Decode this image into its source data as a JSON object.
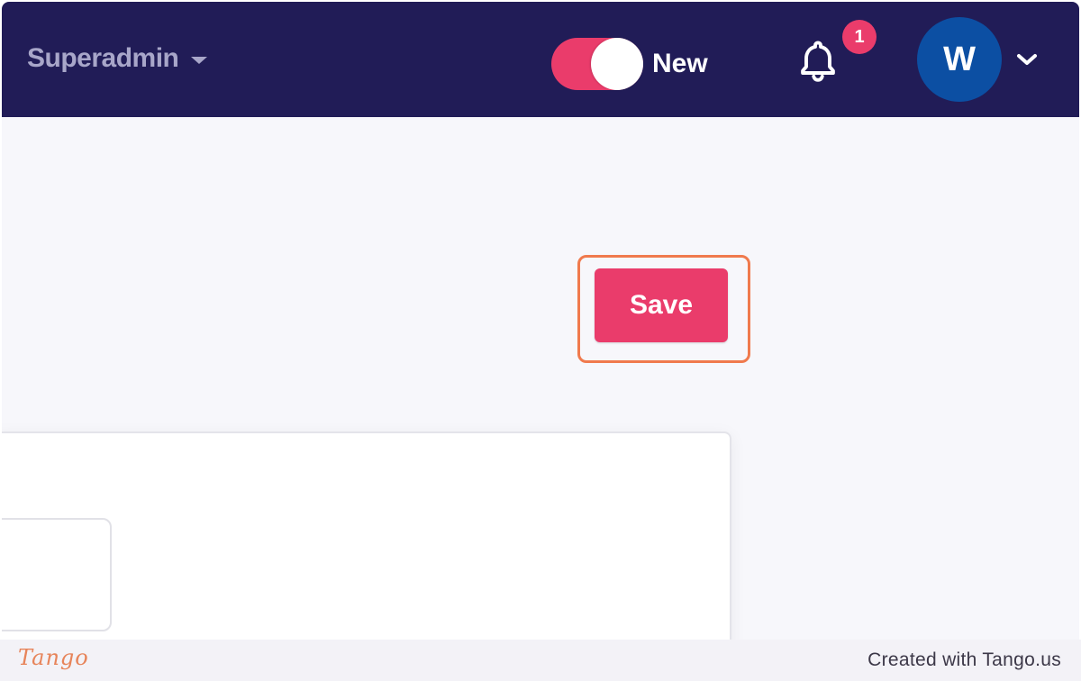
{
  "header": {
    "workspace_label": "Superadmin",
    "toggle_label": "New",
    "notifications_count": "1",
    "avatar_initial": "W"
  },
  "main": {
    "save_label": "Save"
  },
  "footer": {
    "logo_text": "Tango",
    "created_with": "Created with Tango.us"
  },
  "colors": {
    "topbar": "#211c57",
    "accent": "#ea3c6b",
    "avatar": "#0c4fa3",
    "highlight": "#f07a4d"
  },
  "icons": {
    "workspace_caret": "caret-down-icon",
    "notifications": "bell-icon",
    "user_menu": "chevron-down-icon"
  }
}
